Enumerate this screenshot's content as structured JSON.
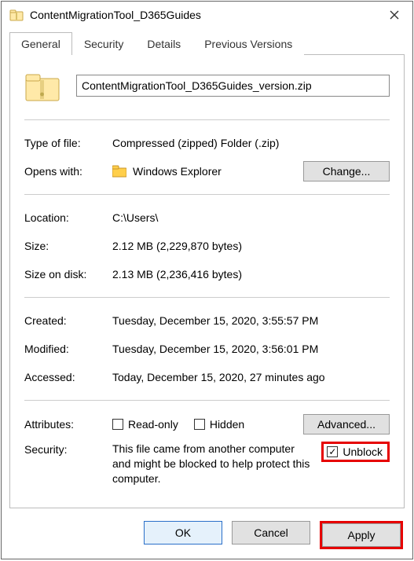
{
  "window": {
    "title": "ContentMigrationTool_D365Guides"
  },
  "tabs": {
    "general": "General",
    "security": "Security",
    "details": "Details",
    "previous": "Previous Versions"
  },
  "file": {
    "name": "ContentMigrationTool_D365Guides_version.zip"
  },
  "labels": {
    "type_of_file": "Type of file:",
    "opens_with": "Opens with:",
    "location": "Location:",
    "size": "Size:",
    "size_on_disk": "Size on disk:",
    "created": "Created:",
    "modified": "Modified:",
    "accessed": "Accessed:",
    "attributes": "Attributes:",
    "security": "Security:"
  },
  "values": {
    "type_of_file": "Compressed (zipped) Folder (.zip)",
    "opens_with_app": "Windows Explorer",
    "location": "C:\\Users\\",
    "size": "2.12 MB (2,229,870 bytes)",
    "size_on_disk": "2.13 MB (2,236,416 bytes)",
    "created": "Tuesday, December 15, 2020, 3:55:57 PM",
    "modified": "Tuesday, December 15, 2020, 3:56:01 PM",
    "accessed": "Today, December 15, 2020, 27 minutes ago"
  },
  "buttons": {
    "change": "Change...",
    "advanced": "Advanced...",
    "ok": "OK",
    "cancel": "Cancel",
    "apply": "Apply"
  },
  "attributes": {
    "readonly_label": "Read-only",
    "hidden_label": "Hidden"
  },
  "security_block": {
    "message": "This file came from another computer and might be blocked to help protect this computer.",
    "unblock_label": "Unblock"
  }
}
